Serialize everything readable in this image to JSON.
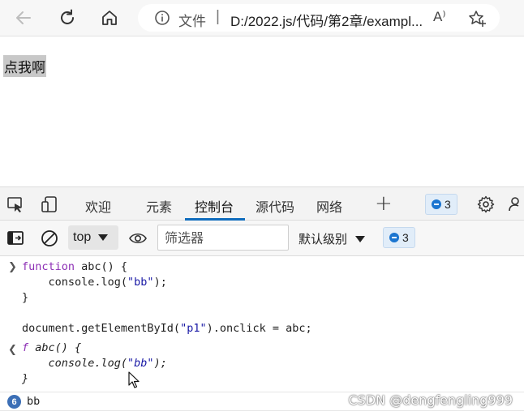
{
  "browser": {
    "address_scheme": "文件",
    "address_separator": "|",
    "address_url": "D:/2022.js/代码/第2章/exampl...",
    "read_aloud": "A⁾"
  },
  "page": {
    "paragraph_text": "点我啊"
  },
  "devtools": {
    "tabs": [
      {
        "label": "欢迎"
      },
      {
        "label": "元素"
      },
      {
        "label": "控制台",
        "active": true
      },
      {
        "label": "源代码"
      },
      {
        "label": "网络"
      }
    ],
    "add_tab_label": "+",
    "issues_count": "3",
    "accent_color": "#0f6cbd"
  },
  "console_toolbar": {
    "context": "top",
    "filter_placeholder": "筛选器",
    "level": "默认级别",
    "issues_count": "3"
  },
  "console": {
    "input_lines": [
      "function abc() {",
      "    console.log(\"bb\");",
      "}",
      "",
      "document.getElementById(\"p1\").onclick = abc;"
    ],
    "result_lines": [
      "f abc() {",
      "    console.log(\"bb\");",
      "}"
    ],
    "log_repeat_count": "6",
    "log_text": "bb"
  },
  "watermark": "CSDN @dengfengling999"
}
